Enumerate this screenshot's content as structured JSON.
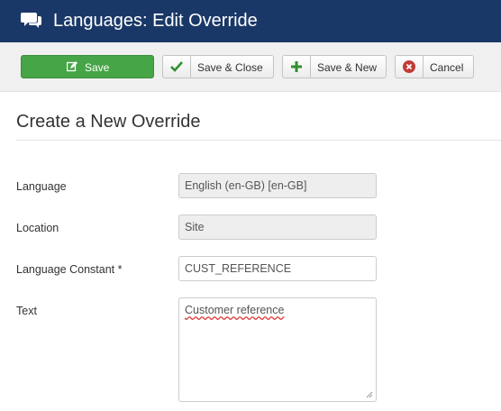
{
  "header": {
    "title": "Languages: Edit Override",
    "icon": "comments-icon"
  },
  "toolbar": {
    "save_label": "Save",
    "save_close_label": "Save & Close",
    "save_new_label": "Save & New",
    "cancel_label": "Cancel"
  },
  "page": {
    "heading": "Create a New Override"
  },
  "form": {
    "language": {
      "label": "Language",
      "value": "English (en-GB) [en-GB]"
    },
    "location": {
      "label": "Location",
      "value": "Site"
    },
    "constant": {
      "label": "Language Constant *",
      "value": "CUST_REFERENCE"
    },
    "text": {
      "label": "Text",
      "value": "Customer reference"
    }
  },
  "colors": {
    "header_bg": "#1a3867",
    "save_green": "#46a546",
    "cancel_red": "#c23b35",
    "check_green": "#2f8f2f"
  }
}
